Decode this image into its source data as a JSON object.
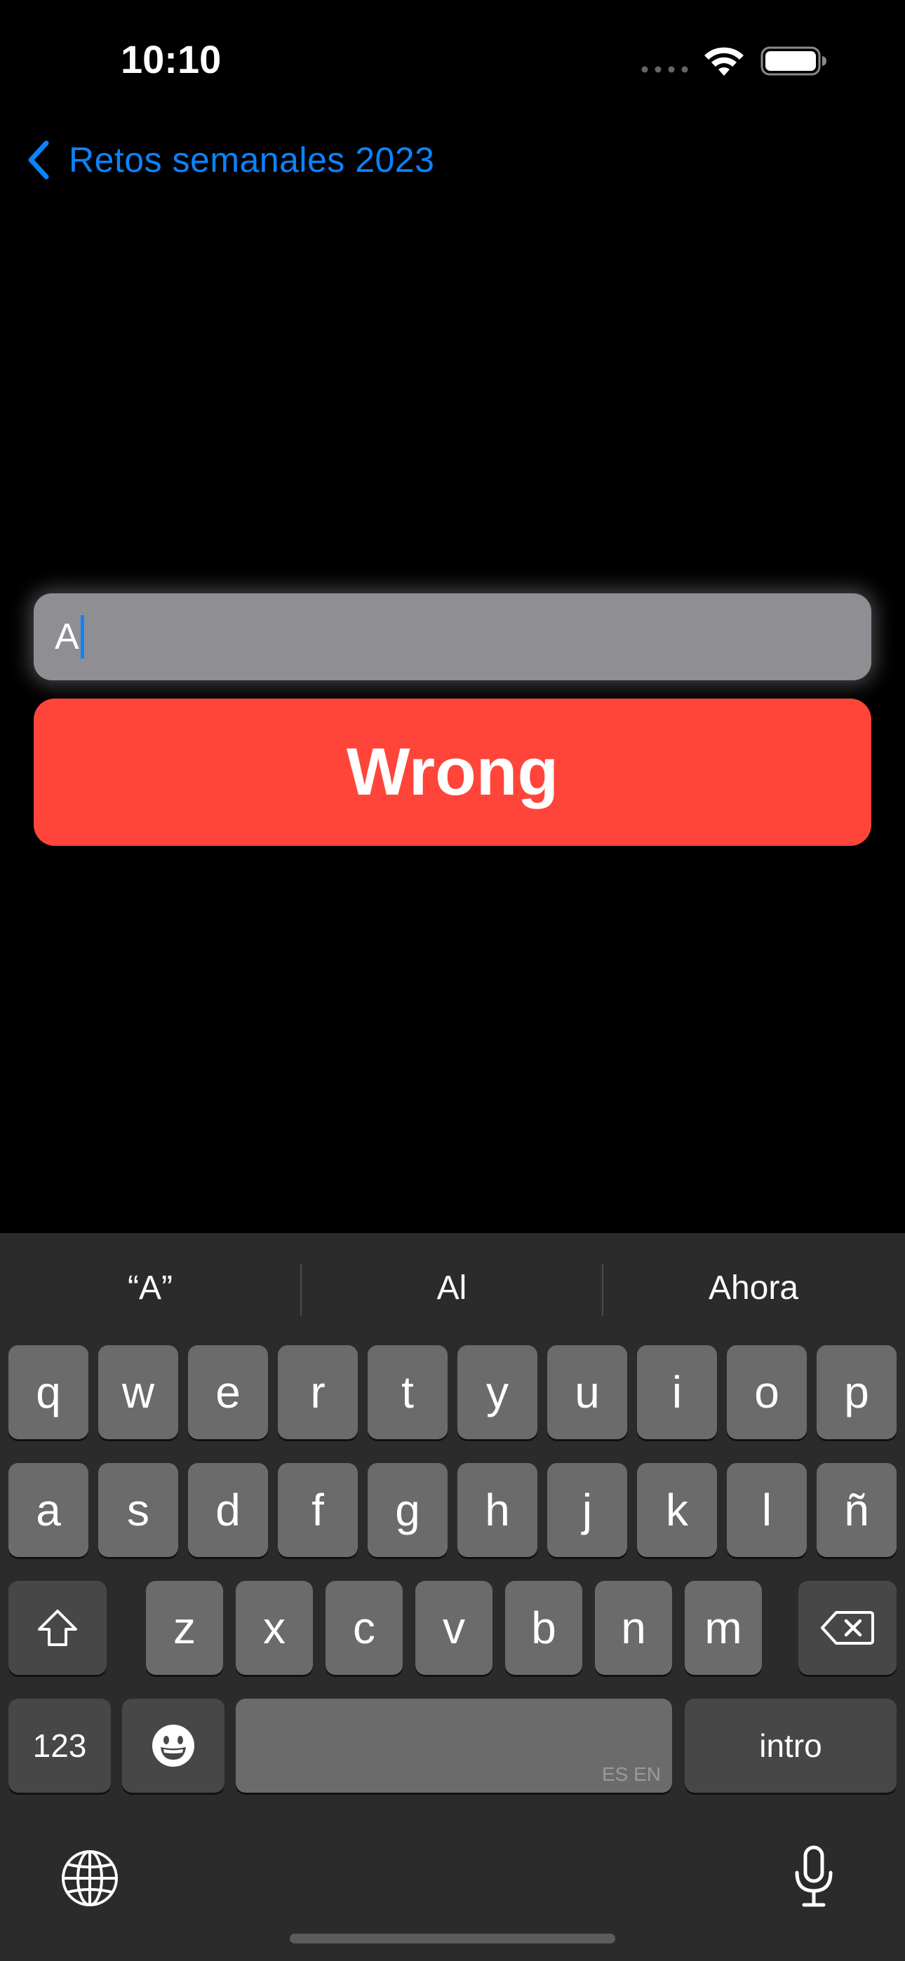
{
  "status_bar": {
    "time": "10:10",
    "icons": [
      "cellular-dots-icon",
      "wifi-icon",
      "battery-icon"
    ]
  },
  "nav": {
    "back_label": "Retos semanales 2023",
    "back_icon": "chevron-left-icon",
    "accent_color": "#0a84ff"
  },
  "answer_field": {
    "value": "A"
  },
  "result_button": {
    "label": "Wrong",
    "color": "#ff453a"
  },
  "keyboard": {
    "suggestions": [
      "“A”",
      "Al",
      "Ahora"
    ],
    "row1": [
      "q",
      "w",
      "e",
      "r",
      "t",
      "y",
      "u",
      "i",
      "o",
      "p"
    ],
    "row2": [
      "a",
      "s",
      "d",
      "f",
      "g",
      "h",
      "j",
      "k",
      "l",
      "ñ"
    ],
    "row3": [
      "z",
      "x",
      "c",
      "v",
      "b",
      "n",
      "m"
    ],
    "numbers_key": "123",
    "space_language": "ES EN",
    "return_key": "intro",
    "icons": [
      "shift-icon",
      "backspace-icon",
      "emoji-icon",
      "globe-icon",
      "microphone-icon"
    ]
  }
}
